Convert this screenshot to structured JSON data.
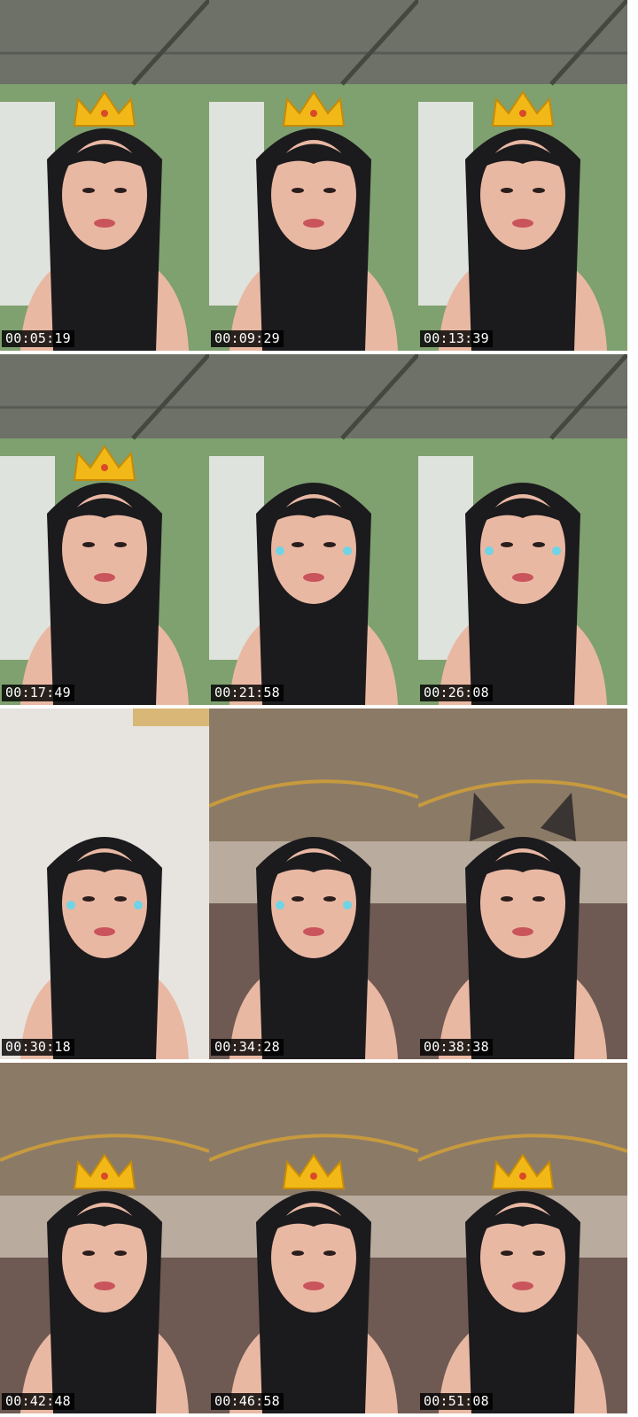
{
  "frames": [
    {
      "timestamp": "00:05:19",
      "scene": "green-room",
      "overlay": "crown"
    },
    {
      "timestamp": "00:09:29",
      "scene": "green-room",
      "overlay": "crown"
    },
    {
      "timestamp": "00:13:39",
      "scene": "green-room",
      "overlay": "crown"
    },
    {
      "timestamp": "00:17:49",
      "scene": "green-room",
      "overlay": "crown"
    },
    {
      "timestamp": "00:21:58",
      "scene": "green-room",
      "overlay": "sparkle-tears"
    },
    {
      "timestamp": "00:26:08",
      "scene": "green-room",
      "overlay": "sparkle-tears"
    },
    {
      "timestamp": "00:30:18",
      "scene": "white-wall",
      "overlay": "sparkle-tears"
    },
    {
      "timestamp": "00:34:28",
      "scene": "hall",
      "overlay": "sparkle-tears"
    },
    {
      "timestamp": "00:38:38",
      "scene": "hall",
      "overlay": "cat-ears"
    },
    {
      "timestamp": "00:42:48",
      "scene": "hall",
      "overlay": "crown"
    },
    {
      "timestamp": "00:46:58",
      "scene": "hall",
      "overlay": "crown"
    },
    {
      "timestamp": "00:51:08",
      "scene": "hall",
      "overlay": "crown"
    }
  ],
  "colors": {
    "green_wall": "#7fa06f",
    "ceiling": "#6d7168",
    "white_wall": "#e7e4df",
    "hall_ceiling": "#8b7a66",
    "hair": "#1b1a1d",
    "skin": "#e9b8a3",
    "tank_top": "#5c5d66",
    "crown": "#f2b817",
    "stamp_bg": "#000000"
  }
}
